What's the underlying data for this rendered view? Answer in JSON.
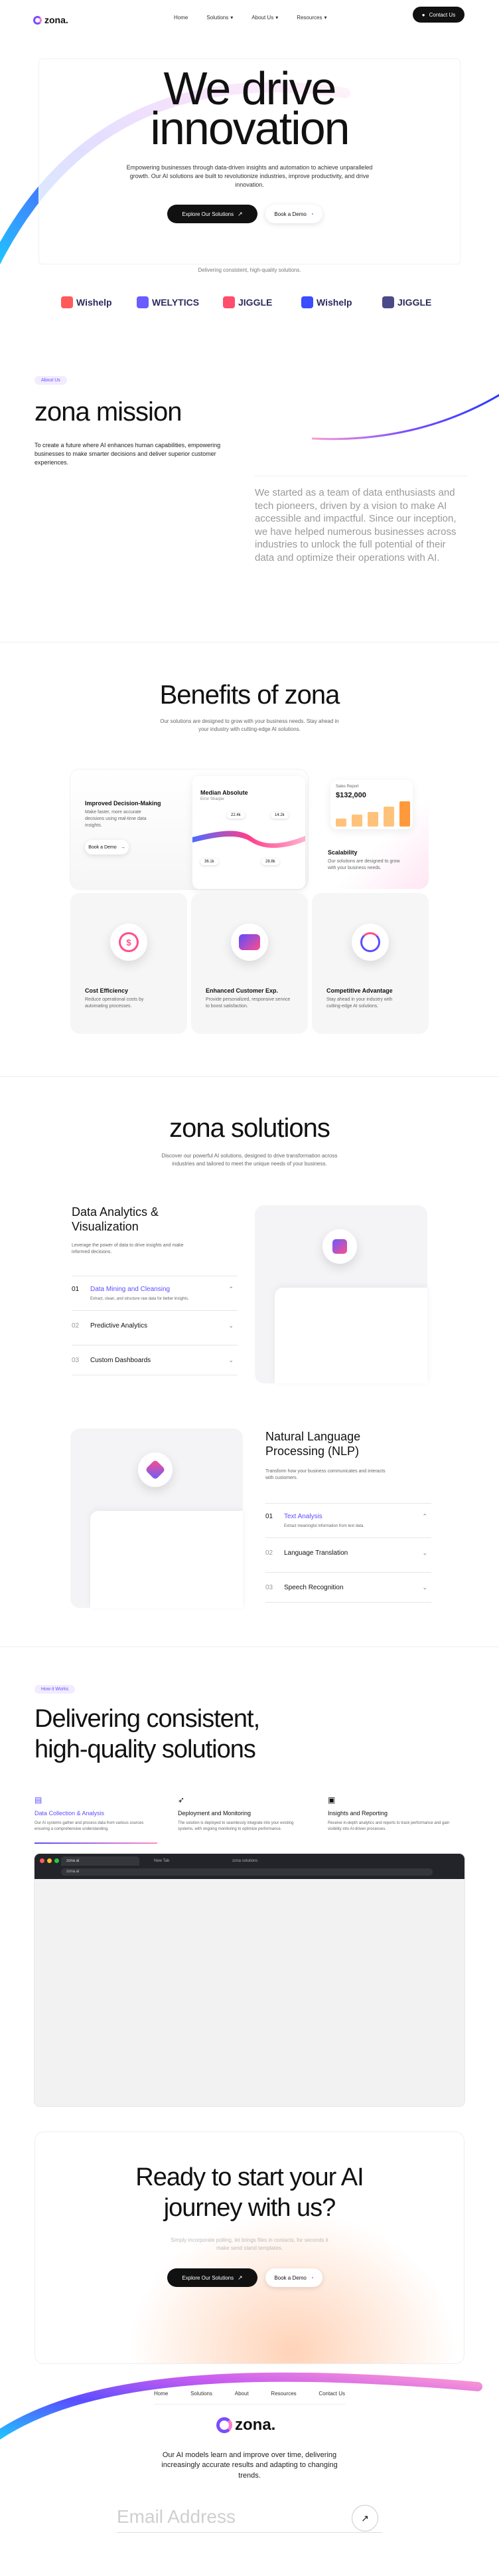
{
  "nav": {
    "logo": "zona.",
    "links": [
      "Home",
      "Solutions",
      "About Us",
      "Resources"
    ],
    "cta": "Contact Us"
  },
  "hero": {
    "title_line1": "We drive",
    "title_line2": "innovation",
    "subtitle": "Empowering businesses through data-driven insights and automation to achieve unparalleled growth. Our AI solutions are built to revolutionize industries, improve productivity, and drive innovation.",
    "primary_cta": "Explore Our Solutions",
    "secondary_cta": "Book a Demo",
    "trust_line": "Delivering consistent, high-quality solutions.",
    "brands": [
      "Wishelp",
      "WELYTICS",
      "JIGGLE",
      "Wishelp",
      "JIGGLE"
    ]
  },
  "mission": {
    "badge": "About Us",
    "title": "zona mission",
    "lead": "To create a future where AI enhances human capabilities, empowering businesses to make smarter decisions and deliver superior customer experiences.",
    "story": "We started as a team of data enthusiasts and tech pioneers, driven by a vision to make AI accessible and impactful. Since our inception, we have helped numerous businesses across industries to unlock the full potential of their data and optimize their operations with AI."
  },
  "benefits": {
    "title": "Benefits of zona",
    "subtitle": "Our solutions are designed to grow with your business needs. Stay ahead in your industry with cutting-edge AI solutions.",
    "decision": {
      "title": "Improved Decision-Making",
      "desc": "Make faster, more accurate decisions using real-time data insights.",
      "cta": "Book a Demo"
    },
    "median": {
      "title": "Median Absolute",
      "sub": "Error Sharpie",
      "tags": [
        "22.4k",
        "36.1k",
        "28.8k"
      ],
      "badge": "14.2k"
    },
    "scalability": {
      "report_label": "Sales Report",
      "report_value": "$132,000",
      "title": "Scalability",
      "desc": "Our solutions are designed to grow with your business needs.",
      "bar_levels": [
        0.3,
        0.45,
        0.55,
        0.75,
        0.95
      ]
    },
    "cards": [
      {
        "title": "Cost Efficiency",
        "desc": "Reduce operational costs by automating processes."
      },
      {
        "title": "Enhanced Customer Exp.",
        "desc": "Provide personalized, responsive service to boost satisfaction."
      },
      {
        "title": "Competitive Advantage",
        "desc": "Stay ahead in your industry with cutting-edge AI solutions."
      }
    ]
  },
  "solutions": {
    "title": "zona solutions",
    "subtitle": "Discover our powerful AI solutions, designed to drive transformation across industries and tailored to meet the unique needs of your business.",
    "block1": {
      "title": "Data Analytics & Visualization",
      "desc": "Leverage the power of data to drive insights and make informed decisions.",
      "items": [
        {
          "num": "01",
          "label": "Data Mining and Cleansing",
          "desc": "Extract, clean, and structure raw data for better insights."
        },
        {
          "num": "02",
          "label": "Predictive Analytics"
        },
        {
          "num": "03",
          "label": "Custom Dashboards"
        }
      ]
    },
    "block2": {
      "title": "Natural Language Processing (NLP)",
      "desc": "Transform how your business communicates and interacts with customers.",
      "items": [
        {
          "num": "01",
          "label": "Text Analysis",
          "desc": "Extract meaningful information from text data."
        },
        {
          "num": "02",
          "label": "Language Translation"
        },
        {
          "num": "03",
          "label": "Speech Recognition"
        }
      ]
    }
  },
  "how": {
    "badge": "How it Works",
    "title_line1": "Delivering consistent,",
    "title_line2": "high-quality solutions",
    "steps": [
      {
        "title": "Data Collection & Analysis",
        "desc": "Our AI systems gather and process data from various sources ensuring a comprehensive understanding."
      },
      {
        "title": "Deployment and Monitoring",
        "desc": "The solution is deployed to seamlessly integrate into your existing systems, with ongoing monitoring to optimize performance."
      },
      {
        "title": "Insights and Reporting",
        "desc": "Receive in-depth analytics and reports to track performance and gain visibility into AI-driven processes."
      }
    ],
    "browser_tabs": [
      "zona ai",
      "New Tab",
      "zona solutions"
    ],
    "browser_url": "zona.ai"
  },
  "cta": {
    "title_line1": "Ready to start your AI",
    "title_line2": "journey with us?",
    "subtitle": "Simply incorporate polling, let brings files in contacts, for seconds it make send stand templates.",
    "primary": "Explore Our Solutions",
    "secondary": "Book a Demo"
  },
  "footer": {
    "links": [
      "Home",
      "Solutions",
      "About",
      "Resources",
      "Contact Us"
    ],
    "logo": "zona.",
    "tagline": "Our AI models learn and improve over time, delivering increasingly accurate results and adapting to changing trends.",
    "email_placeholder": "Email Address"
  }
}
